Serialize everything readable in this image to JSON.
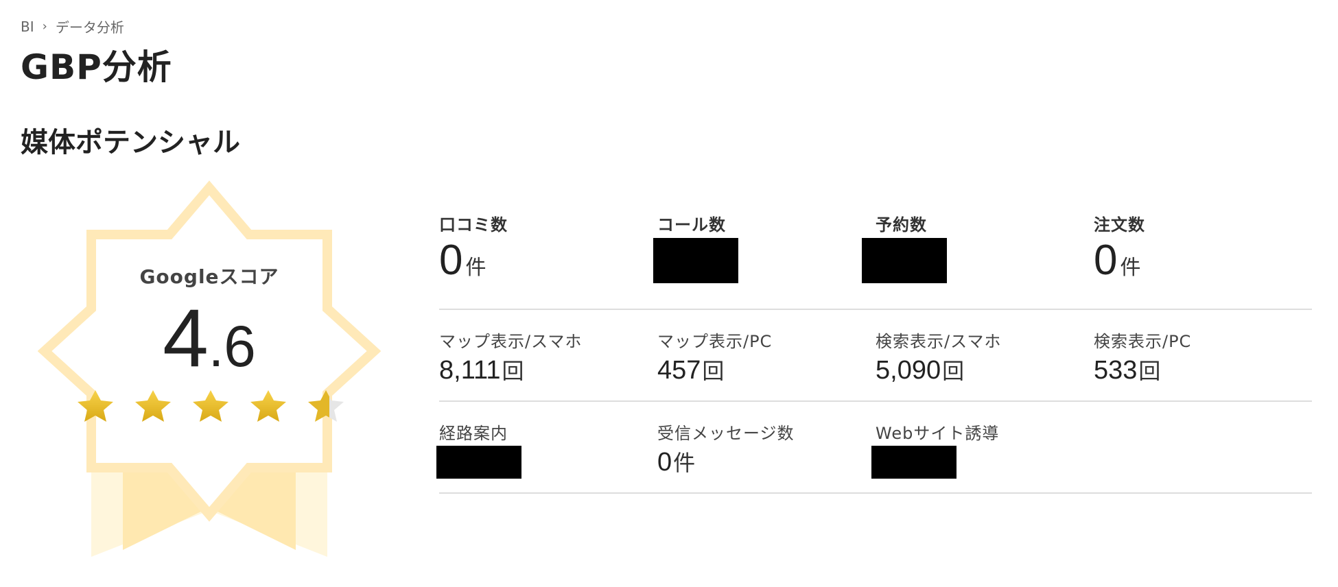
{
  "breadcrumb": {
    "root": "BI",
    "current": "データ分析"
  },
  "page_title": "GBP分析",
  "section_title": "媒体ポテンシャル",
  "score": {
    "label": "Googleスコア",
    "integer": "4",
    "dot": ".",
    "decimal": "6",
    "rating": 4.6,
    "max_stars": 5
  },
  "metrics": {
    "row1": [
      {
        "label": "口コミ数",
        "value": "0",
        "unit": "件"
      },
      {
        "label": "コール数"
      },
      {
        "label": "予約数"
      },
      {
        "label": "注文数",
        "value": "0",
        "unit": "件"
      }
    ],
    "row2": [
      {
        "label": "マップ表示/スマホ",
        "value": "8,111",
        "unit": "回"
      },
      {
        "label": "マップ表示/PC",
        "value": "457",
        "unit": "回"
      },
      {
        "label": "検索表示/スマホ",
        "value": "5,090",
        "unit": "回"
      },
      {
        "label": "検索表示/PC",
        "value": "533",
        "unit": "回"
      }
    ],
    "row3": [
      {
        "label": "経路案内"
      },
      {
        "label": "受信メッセージ数",
        "value": "0",
        "unit": "件"
      },
      {
        "label": "Webサイト誘導"
      }
    ]
  },
  "colors": {
    "badge_light": "#FFF6DC",
    "badge_mid": "#FFE8B0",
    "badge_stroke": "#FFE9B8",
    "star_gold": "#E3B728",
    "star_empty": "#E6E6E6",
    "divider": "#DDDDDD"
  }
}
